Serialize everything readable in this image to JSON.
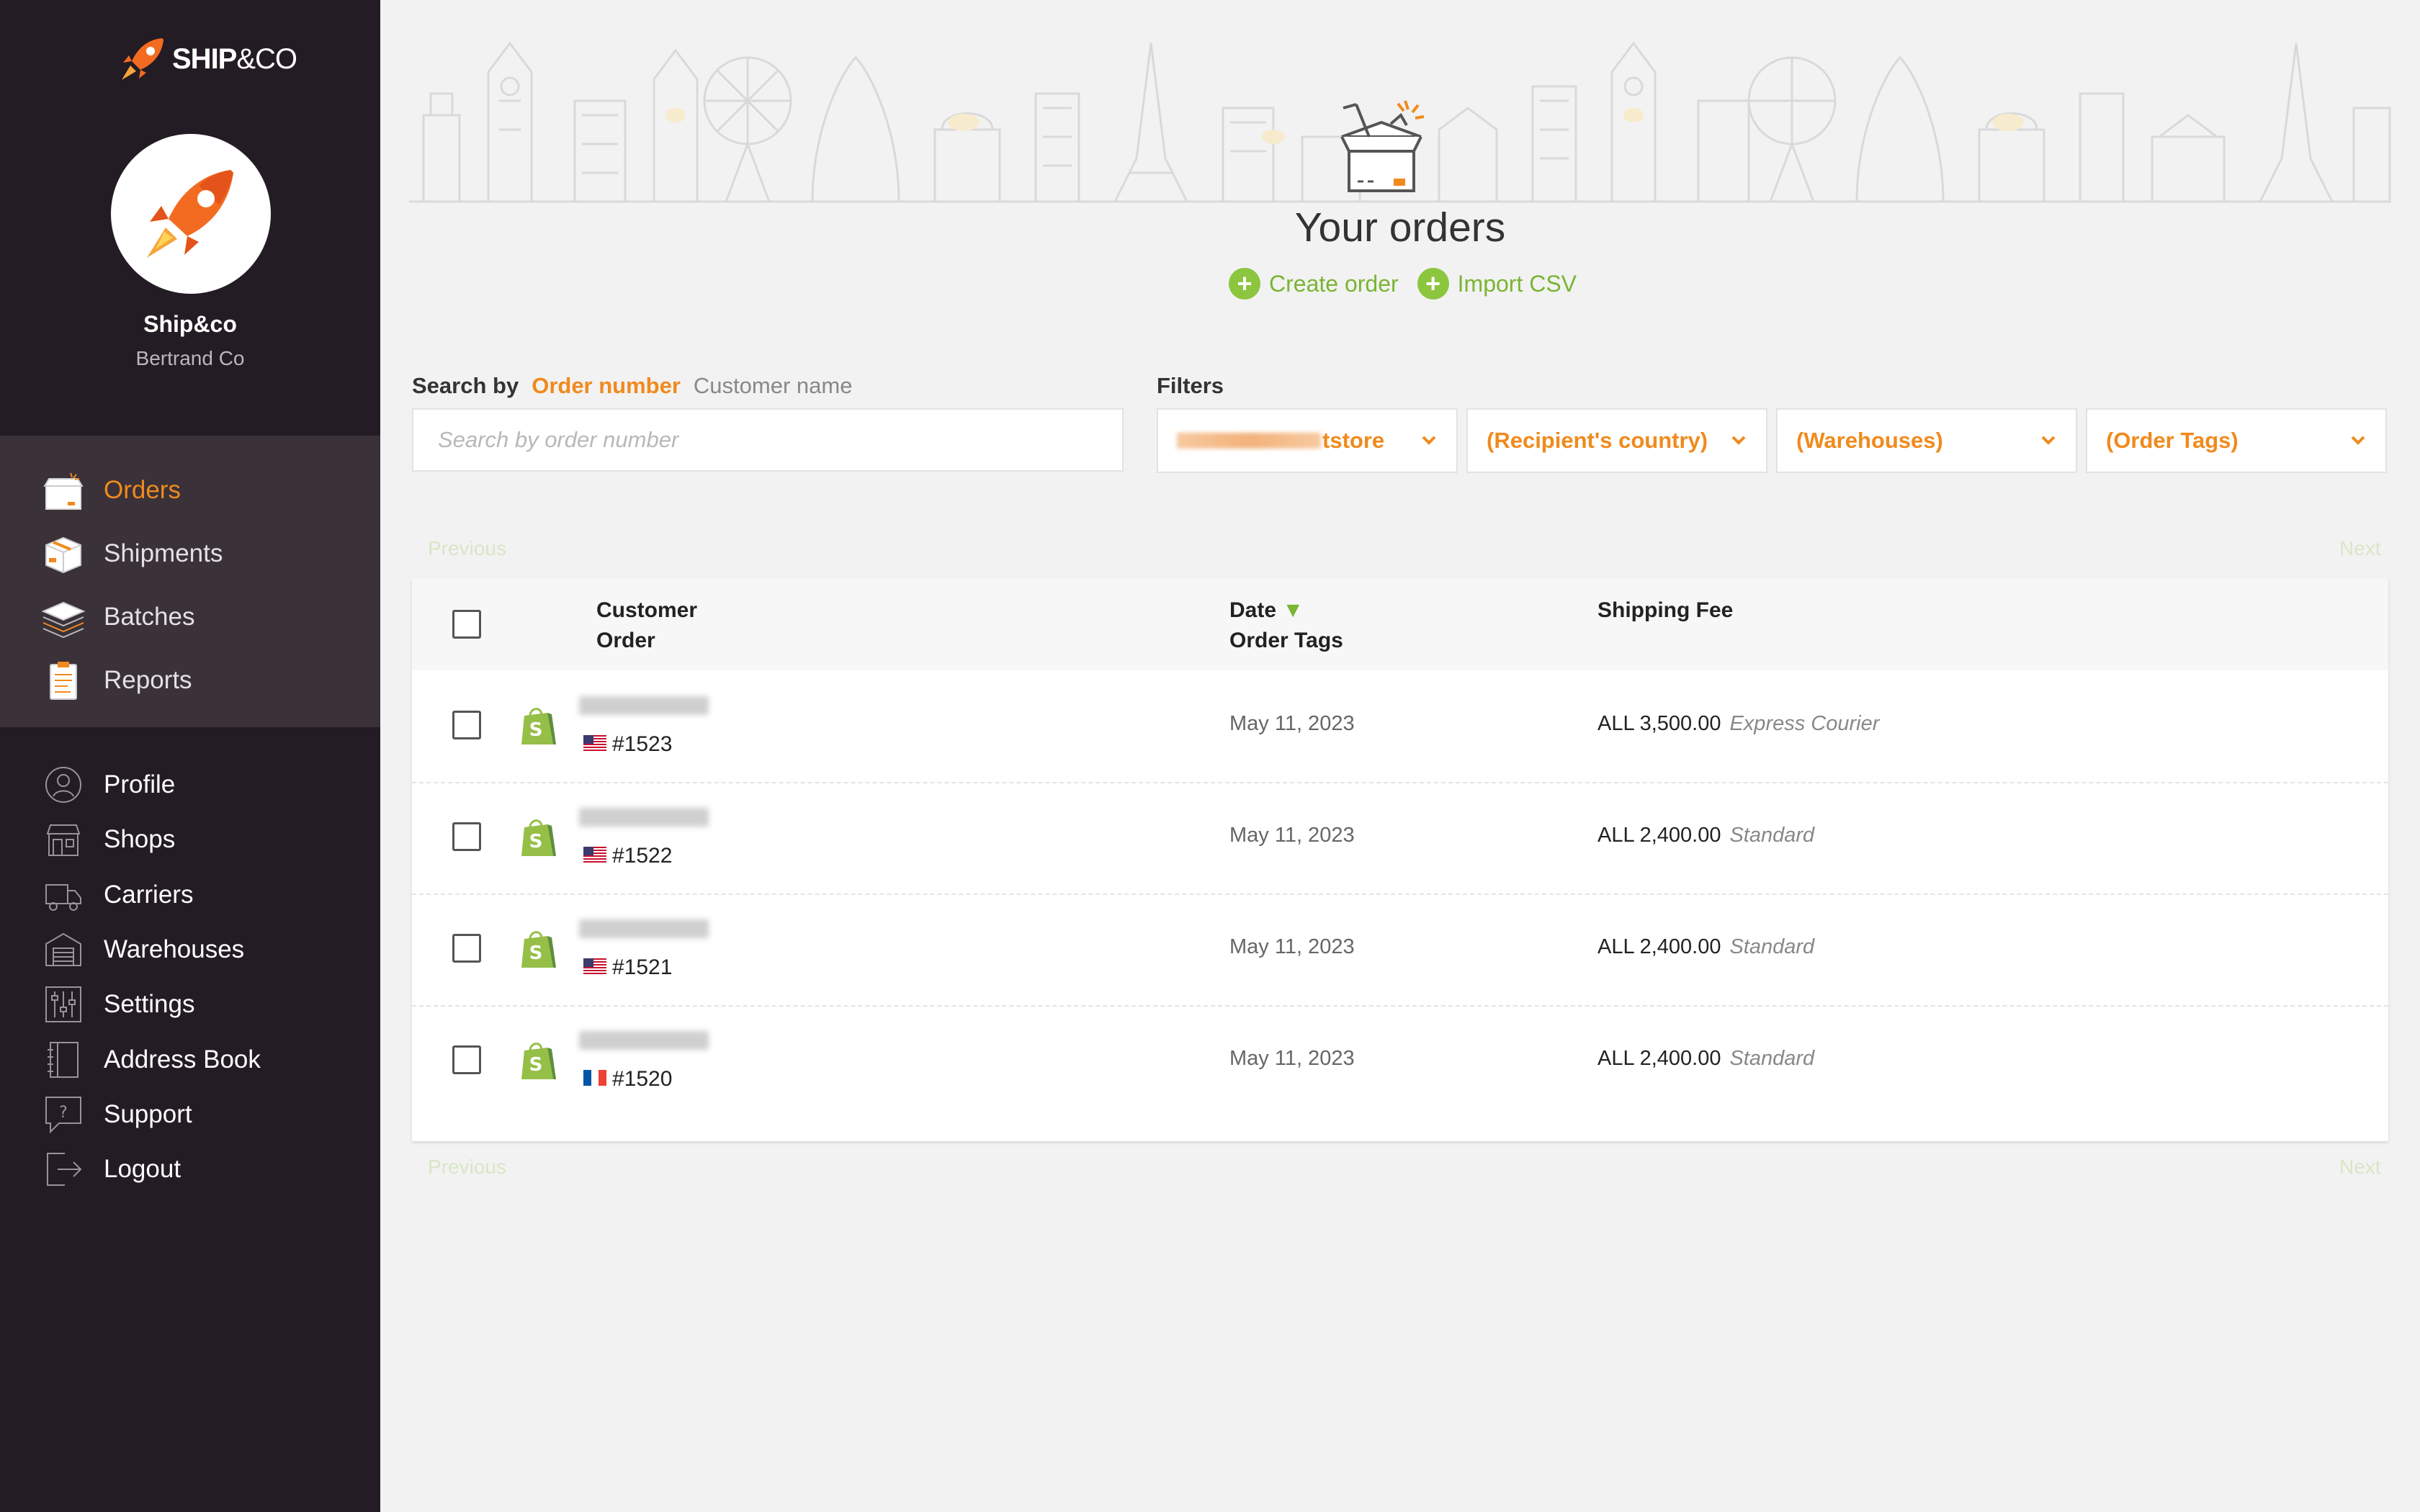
{
  "app": {
    "logo_text": "SHIP",
    "logo_amp": "&CO"
  },
  "account": {
    "name": "Ship&co",
    "subtitle": "Bertrand Co"
  },
  "nav_main": [
    {
      "label": "Orders",
      "icon": "orders-box-icon",
      "active": true
    },
    {
      "label": "Shipments",
      "icon": "shipment-box-icon"
    },
    {
      "label": "Batches",
      "icon": "batches-stack-icon"
    },
    {
      "label": "Reports",
      "icon": "clipboard-report-icon"
    }
  ],
  "nav_secondary": [
    {
      "label": "Profile",
      "icon": "user-icon"
    },
    {
      "label": "Shops",
      "icon": "store-icon"
    },
    {
      "label": "Carriers",
      "icon": "truck-icon"
    },
    {
      "label": "Warehouses",
      "icon": "warehouse-icon"
    },
    {
      "label": "Settings",
      "icon": "sliders-icon"
    },
    {
      "label": "Address Book",
      "icon": "address-book-icon"
    },
    {
      "label": "Support",
      "icon": "help-bubble-icon"
    },
    {
      "label": "Logout",
      "icon": "logout-icon"
    }
  ],
  "page": {
    "title": "Your orders",
    "actions": {
      "create": "Create order",
      "import": "Import CSV"
    }
  },
  "search": {
    "label": "Search by",
    "option_active": "Order number",
    "option_other": "Customer name",
    "placeholder": "Search by order number",
    "value": ""
  },
  "filters": {
    "label": "Filters",
    "store_suffix": "tstore",
    "country": "(Recipient's country)",
    "warehouses": "(Warehouses)",
    "tags": "(Order Tags)"
  },
  "pager": {
    "previous": "Previous",
    "next": "Next"
  },
  "table": {
    "headers": {
      "customer": "Customer",
      "order": "Order",
      "date": "Date",
      "order_tags": "Order Tags",
      "shipping_fee": "Shipping Fee"
    },
    "sort_indicator": "▼",
    "rows": [
      {
        "order": "#1523",
        "flag": "us",
        "date": "May 11, 2023",
        "fee": "ALL 3,500.00",
        "service": "Express Courier"
      },
      {
        "order": "#1522",
        "flag": "us",
        "date": "May 11, 2023",
        "fee": "ALL 2,400.00",
        "service": "Standard"
      },
      {
        "order": "#1521",
        "flag": "us",
        "date": "May 11, 2023",
        "fee": "ALL 2,400.00",
        "service": "Standard"
      },
      {
        "order": "#1520",
        "flag": "fr",
        "date": "May 11, 2023",
        "fee": "ALL 2,400.00",
        "service": "Standard"
      }
    ]
  },
  "colors": {
    "accent": "#f08a1d",
    "green": "#8cc63f",
    "sidebar": "#241c24",
    "sidebar_active_bg": "#3a3139"
  }
}
